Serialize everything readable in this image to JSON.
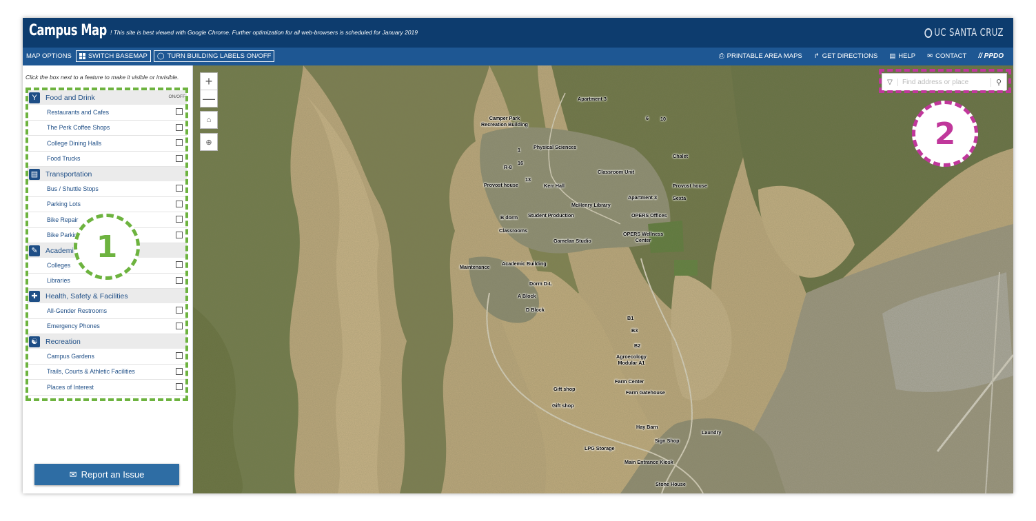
{
  "header": {
    "title": "Campus Map",
    "notice": "! This site is best viewed with Google Chrome. Further optimization for all web-browsers is scheduled for January 2019",
    "brand": "UC SANTA CRUZ"
  },
  "toolbar": {
    "map_options": "MAP OPTIONS",
    "switch_basemap": "SWITCH BASEMAP",
    "building_labels": "TURN BUILDING LABELS ON/OFF",
    "printable_maps": "PRINTABLE AREA MAPS",
    "directions": "GET DIRECTIONS",
    "help": "HELP",
    "contact": "CONTACT",
    "ppdo": "// PPDO"
  },
  "sidebar": {
    "hint": "Click the box next to a feature to make it visible or invisible.",
    "onoff": "ON/OFF",
    "categories": [
      {
        "label": "Food and Drink",
        "icon": "fork-knife-icon",
        "items": [
          "Restaurants and Cafes",
          "The Perk Coffee Shops",
          "College Dining Halls",
          "Food Trucks"
        ]
      },
      {
        "label": "Transportation",
        "icon": "bus-icon",
        "items": [
          "Bus / Shuttle Stops",
          "Parking Lots",
          "Bike Repair",
          "Bike Parking"
        ]
      },
      {
        "label": "Academics",
        "icon": "academics-icon",
        "items": [
          "Colleges",
          "Libraries"
        ]
      },
      {
        "label": "Health, Safety & Facilities",
        "icon": "cross-icon",
        "items": [
          "All-Gender Restrooms",
          "Emergency Phones"
        ]
      },
      {
        "label": "Recreation",
        "icon": "runner-icon",
        "items": [
          "Campus Gardens",
          "Trails, Courts & Athletic Facilities",
          "Places of Interest"
        ]
      }
    ],
    "report": "Report an Issue"
  },
  "annotations": {
    "badge1": "1",
    "badge2": "2",
    "green": "#6db33f",
    "magenta": "#c0379b"
  },
  "map": {
    "search_placeholder": "Find address or place",
    "labels": [
      "Apartment 3",
      "Camper Park\nRecreation Building",
      "6",
      "10",
      "Physical Sciences",
      "1",
      "Chalet",
      "16",
      "R-8",
      "Classroom Unit",
      "Provost house",
      "13",
      "Kerr Hall",
      "Provost house",
      "Apartment 3",
      "Sexta",
      "McHenry Library",
      "B dorm",
      "Student Production",
      "OPERS Offices",
      "Classrooms",
      "OPERS Wellness\nCenter",
      "Gamelan Studio",
      "Maintenance",
      "Academic Building",
      "Dorm D-L",
      "A Block",
      "D Block",
      "B1",
      "B3",
      "B2",
      "Agroecology\nModular A1",
      "Farm Center",
      "Gift shop",
      "Farm Gatehouse",
      "Gift shop",
      "Hay Barn",
      "Laundry",
      "Sign Shop",
      "LPG Storage",
      "Main Entrance Kiosk",
      "Stone House"
    ]
  }
}
